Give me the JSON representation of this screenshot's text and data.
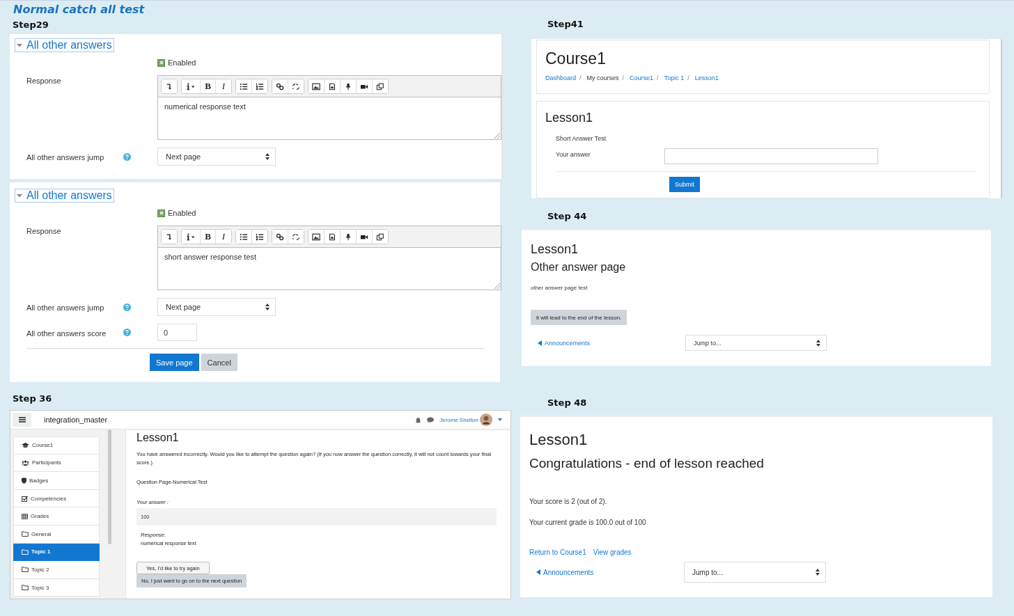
{
  "title": "Normal catch all test",
  "step29": {
    "label": "Step29",
    "sections": [
      {
        "header": "All other answers",
        "expanded": true,
        "enabled": {
          "label": "Enabled",
          "checked": true
        },
        "response_label": "Response",
        "editor": {
          "bold": "B",
          "italic": "I",
          "text": "numerical response text"
        },
        "jump": {
          "label": "All other answers jump",
          "value": "Next page"
        }
      },
      {
        "header": "All other answers",
        "expanded": true,
        "enabled": {
          "label": "Enabled",
          "checked": true
        },
        "response_label": "Response",
        "editor": {
          "bold": "B",
          "italic": "I",
          "text": "short answer response test"
        },
        "jump": {
          "label": "All other answers jump",
          "value": "Next page"
        },
        "score": {
          "label": "All other answers score",
          "value": "0"
        },
        "buttons": [
          {
            "label": "Save page",
            "kind": "primary"
          },
          {
            "label": "Cancel",
            "kind": "secondary"
          }
        ]
      }
    ]
  },
  "step36": {
    "label": "Step 36",
    "navbar": {
      "site": "integration_master",
      "user": "Jerome Shelton"
    },
    "nav": [
      {
        "label": "Course1",
        "kind": "course",
        "selected": false
      },
      {
        "label": "Participants",
        "kind": "people",
        "selected": false
      },
      {
        "label": "Badges",
        "kind": "badge",
        "selected": false
      },
      {
        "label": "Competencies",
        "kind": "check",
        "selected": false
      },
      {
        "label": "Grades",
        "kind": "table",
        "selected": false
      },
      {
        "label": "General",
        "kind": "folder",
        "selected": false
      },
      {
        "label": "Topic 1",
        "kind": "folder",
        "selected": true
      },
      {
        "label": "Topic 2",
        "kind": "folder",
        "selected": false
      },
      {
        "label": "Topic 3",
        "kind": "folder",
        "selected": false
      }
    ],
    "heading": "Lesson1",
    "message": "You have answered incorrectly. Would you like to attempt the question again? (If you now answer the question correctly, it will not count towards your final score.)",
    "question": "Question Page-Numerical Test",
    "answer_label": "Your answer :",
    "answer": "100",
    "response_label": "*Response*:",
    "response": "numerical response text",
    "buttons": [
      {
        "label": "Yes, I'd like to try again",
        "kind": "default"
      },
      {
        "label": "No, I just want to go on to the next question",
        "kind": "secondary"
      }
    ]
  },
  "step41": {
    "label": "Step41",
    "course": "Course1",
    "breadcrumb": [
      {
        "label": "Dashboard",
        "link": true,
        "separator": "/"
      },
      {
        "label": "My courses",
        "link": false,
        "separator": "/"
      },
      {
        "label": "Course1",
        "link": true,
        "separator": "/"
      },
      {
        "label": "Topic 1",
        "link": true,
        "separator": "/"
      },
      {
        "label": "Lesson1",
        "link": true
      }
    ],
    "heading": "Lesson1",
    "question": "Short Answer Test",
    "answer_label": "Your answer",
    "submit": "Submit"
  },
  "step44": {
    "label": "Step 44",
    "heading": "Lesson1",
    "subheading": "Other answer page",
    "text": "other answer page test",
    "button": "it will lead to the end of the lesson.",
    "prev_link": "Announcements",
    "jump": "Jump to..."
  },
  "step48": {
    "label": "Step 48",
    "heading": "Lesson1",
    "subheading": "Congratulations - end of lesson reached",
    "score": "Your score is 2 (out of 2).",
    "grade": "Your current grade is 100.0 out of 100",
    "links": [
      "Return to Course1",
      "View grades"
    ],
    "prev_link": "Announcements",
    "jump": "Jump to..."
  }
}
